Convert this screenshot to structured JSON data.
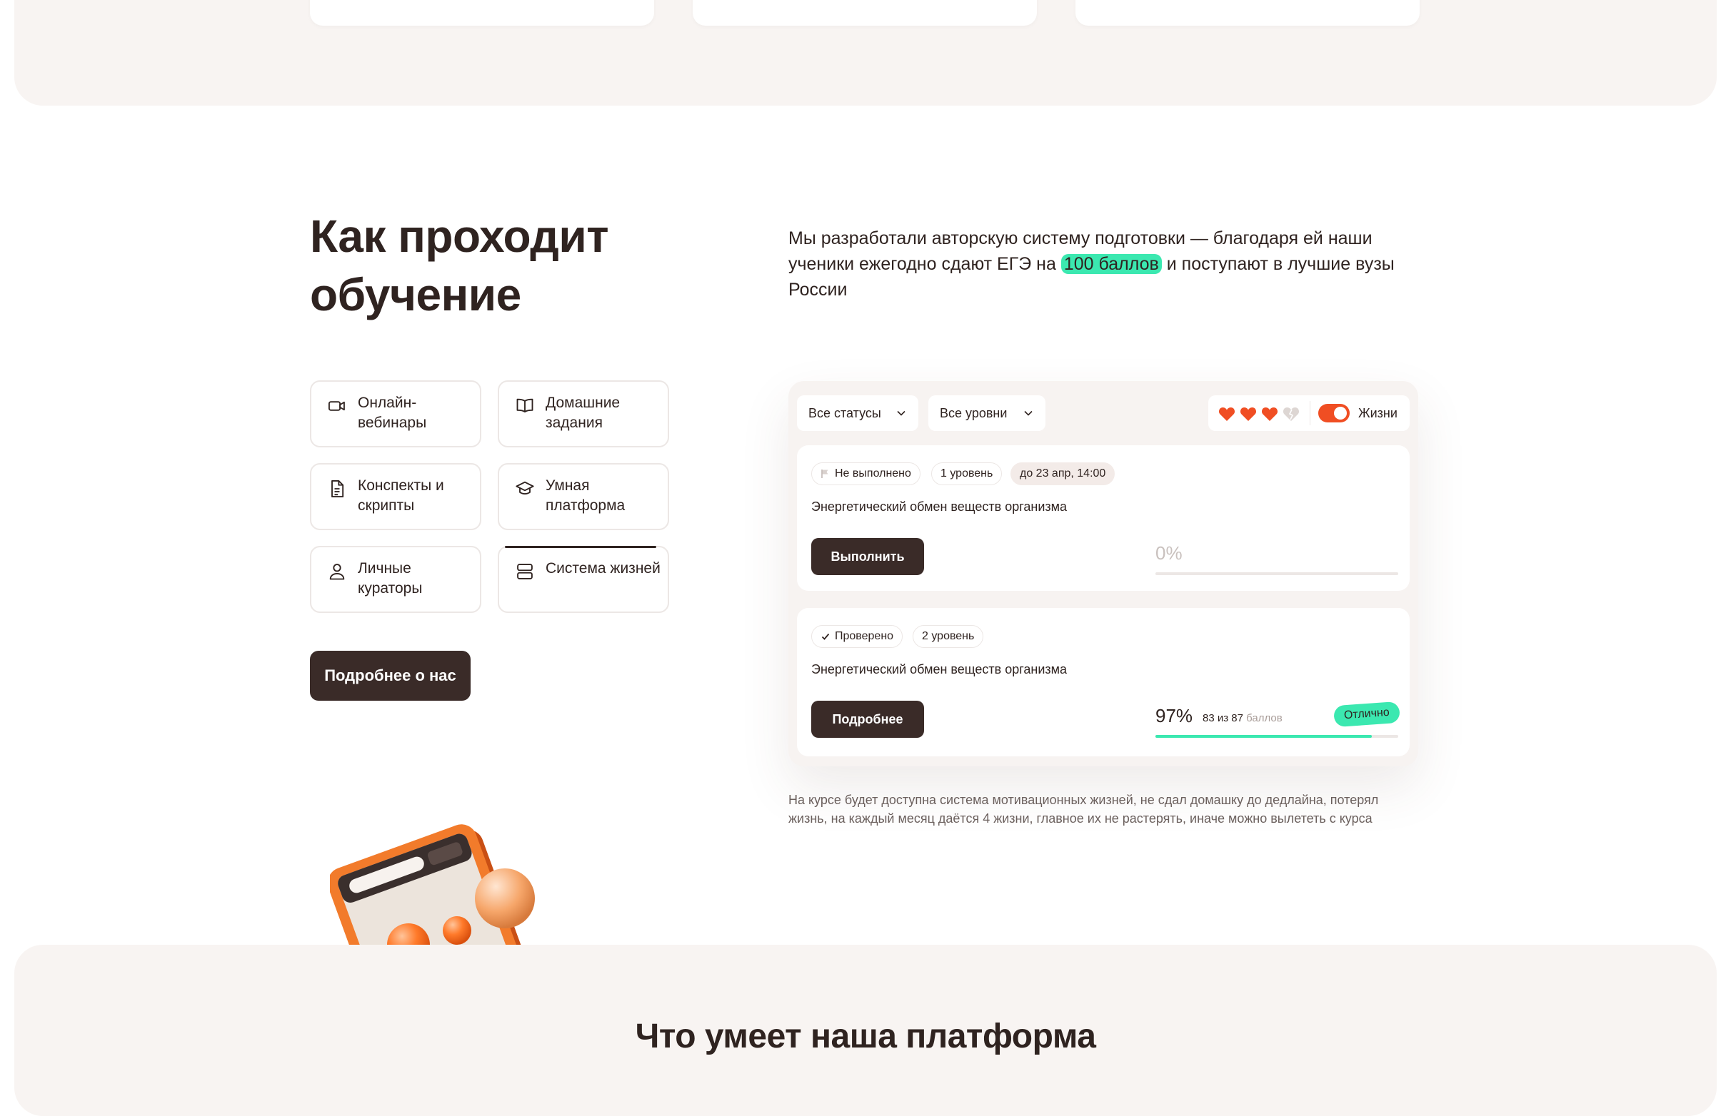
{
  "section": {
    "heading": "Как проходит обучение",
    "intro_before": "Мы разработали авторскую систему подготовки — благодаря ей наши ученики ежегодно сдают ЕГЭ на",
    "intro_highlight": "100 баллов",
    "intro_after": "и поступают в лучшие вузы России",
    "cta_label": "Подробнее о нас",
    "bottom_title": "Что умеет наша платформа"
  },
  "features": [
    {
      "label": "Онлайн-вебинары",
      "icon": "video-camera-icon"
    },
    {
      "label": "Домашние задания",
      "icon": "open-book-icon"
    },
    {
      "label": "Конспекты и скрипты",
      "icon": "document-icon"
    },
    {
      "label": "Умная платформа",
      "icon": "graduation-cap-icon"
    },
    {
      "label": "Личные кураторы",
      "icon": "person-icon"
    },
    {
      "label": "Система жизней",
      "icon": "server-stack-icon",
      "active": true
    }
  ],
  "dashboard": {
    "filter_status": "Все статусы",
    "filter_level": "Все уровни",
    "lives_label": "Жизни",
    "lives_total": 4,
    "lives_remaining": 3,
    "lives_toggle_on": true,
    "tasks": [
      {
        "status": "Не выполнено",
        "level": "1 уровень",
        "deadline": "до 23 апр, 14:00",
        "title": "Энергетический обмен веществ организма",
        "button": "Выполнить",
        "percent_text": "0%",
        "progress": 0
      },
      {
        "status": "Проверено",
        "level": "2 уровень",
        "title": "Энергетический обмен веществ организма",
        "button": "Подробнее",
        "percent_text": "97%",
        "score_text": "83 из 87",
        "score_unit": "баллов",
        "grade": "Отлично",
        "progress": 0.89
      }
    ],
    "note": "На курсе будет доступна система мотивационных жизней, не сдал домашку до дедлайна, потерял жизнь, на каждый месяц даётся 4 жизни, главное их не растерять, иначе можно вылететь с курса"
  },
  "colors": {
    "text": "#2f2320",
    "beige": "#f8f4f2",
    "accent_green": "#3be8b0",
    "accent_orange": "#f04e23",
    "button_dark": "#3a2b28"
  }
}
